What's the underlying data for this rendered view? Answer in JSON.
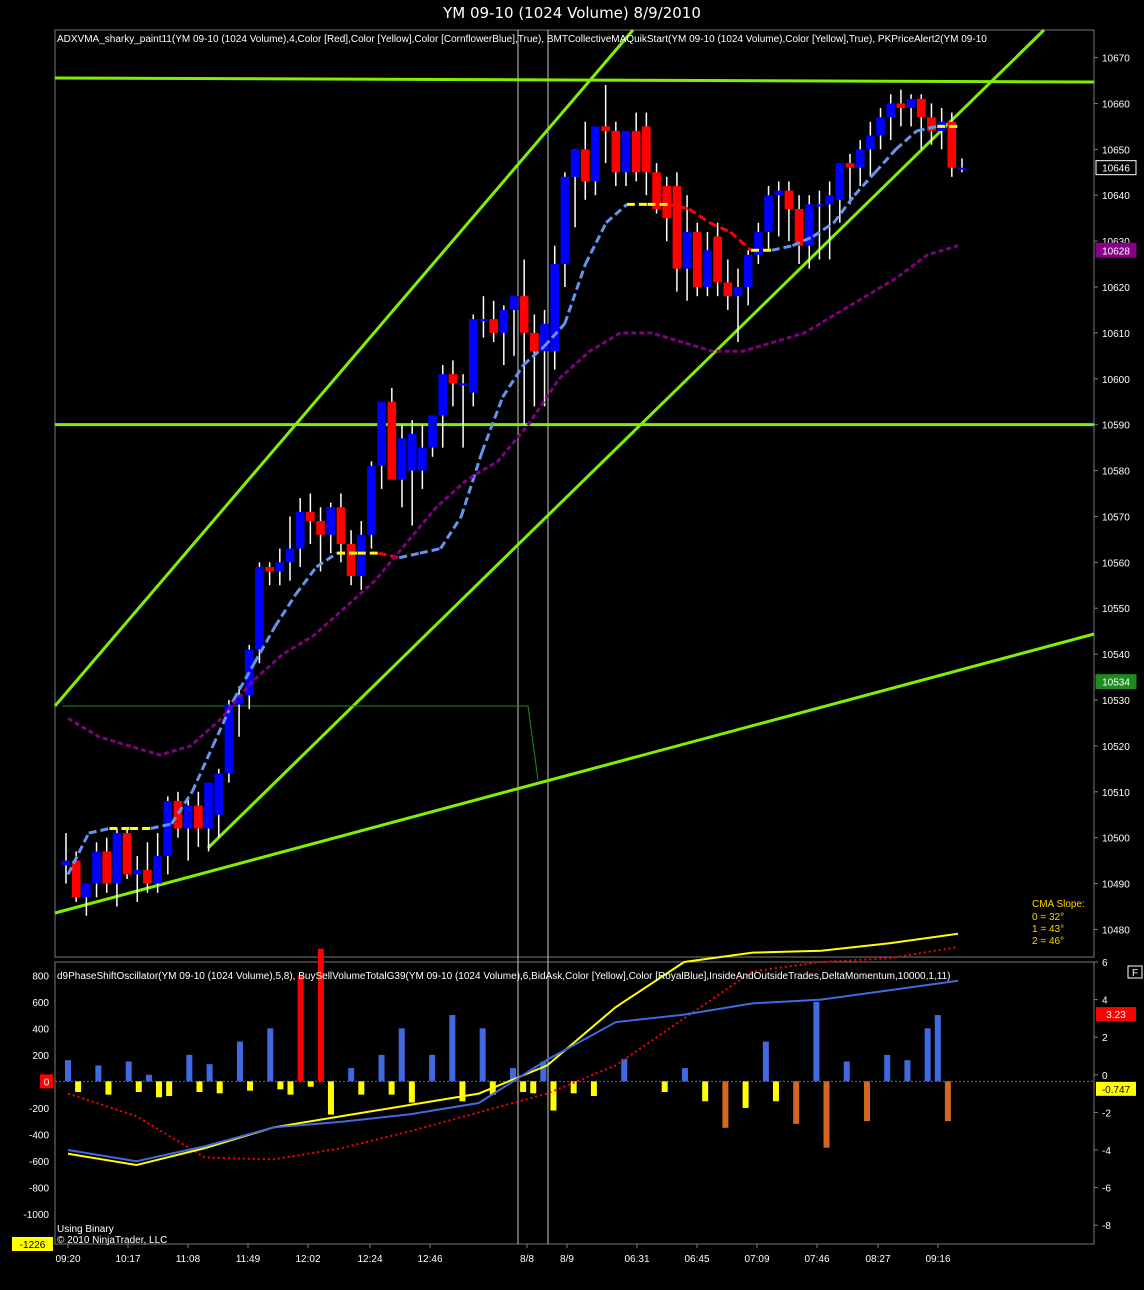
{
  "window": {
    "title": "YM 09-10 (1024 Volume)  8/9/2010"
  },
  "colors": {
    "bg": "#000000",
    "frame": "#7a7a7a",
    "up": "#0000ff",
    "down": "#ff0000",
    "trend": "#80f000",
    "cma_cool": "#6495ed",
    "cma_flat": "#ffff00",
    "cma_down": "#ff0000",
    "ma2": "#800080",
    "osc_fast": "#4169e1",
    "osc_slow": "#ffff00",
    "osc_sig": "#ff0000",
    "bar_up": "#4169e1",
    "bar_dn": "#ffff00"
  },
  "price_panel": {
    "header": "ADXVMA_sharky_paint11(YM 09-10 (1024 Volume),4,Color [Red],Color [Yellow],Color [CornflowerBlue],True), BMTCollectiveMAQuikStart(YM 09-10 (1024 Volume),Color [Yellow],True), PKPriceAlert2(YM 09-10",
    "cma_slope": {
      "title": "CMA Slope:",
      "lines": [
        "0 = 32°",
        "1 = 43°",
        "2 = 46°"
      ]
    },
    "price_tags": [
      {
        "text": "10646",
        "value": 10646,
        "bg": "#000000",
        "fg": "#ffffff",
        "border": "#ffffff"
      },
      {
        "text": "10628",
        "value": 10628,
        "bg": "#8b008b",
        "fg": "#ffffff",
        "border": "#8b008b"
      },
      {
        "text": "10534",
        "value": 10534,
        "bg": "#1e8b1e",
        "fg": "#ffffff",
        "border": "#1e8b1e"
      }
    ]
  },
  "osc_panel": {
    "header": "d9PhaseShiftOscillator(YM 09-10 (1024 Volume),5,8), BuySellVolumeTotalG39(YM 09-10 (1024 Volume),6,BidAsk,Color [Yellow],Color [RoyalBlue],InsideAndOutsideTrades,DeltaMomentum,10000,1,11)",
    "left_tags": [
      {
        "text": "0",
        "value": 0,
        "bg": "#ff0000"
      },
      {
        "text": "-1226",
        "value": -1226,
        "bg": "#ffff00"
      }
    ],
    "right_tags": [
      {
        "text": "3.23",
        "value": 3.23,
        "bg": "#ff0000",
        "fg": "#ffffff"
      },
      {
        "text": "-0.747",
        "value": -0.747,
        "bg": "#ffff00",
        "fg": "#000000"
      }
    ],
    "notes": [
      "Using Binary",
      "© 2010 NinjaTrader, LLC"
    ],
    "corner_label": "F"
  },
  "chart_data": [
    {
      "type": "candlestick",
      "title": "YM 09-10 (1024 Volume)  8/9/2010",
      "ylim": [
        10474,
        10676
      ],
      "y_ticks": [
        10670,
        10660,
        10650,
        10640,
        10630,
        10620,
        10610,
        10600,
        10590,
        10580,
        10570,
        10560,
        10550,
        10540,
        10530,
        10520,
        10510,
        10500,
        10490,
        10480
      ],
      "x_tick_labels": [
        "09:20",
        "10:17",
        "11:08",
        "11:49",
        "12:02",
        "12:24",
        "12:46",
        "8/8",
        "8/9",
        "06:31",
        "06:45",
        "07:09",
        "07:46",
        "08:27",
        "09:16"
      ],
      "candles": [
        {
          "o": 10494,
          "h": 10501,
          "l": 10490,
          "c": 10495
        },
        {
          "o": 10495,
          "h": 10497,
          "l": 10486,
          "c": 10487
        },
        {
          "o": 10487,
          "h": 10490,
          "l": 10483,
          "c": 10490
        },
        {
          "o": 10490,
          "h": 10499,
          "l": 10487,
          "c": 10497
        },
        {
          "o": 10497,
          "h": 10500,
          "l": 10488,
          "c": 10490
        },
        {
          "o": 10490,
          "h": 10502,
          "l": 10485,
          "c": 10501
        },
        {
          "o": 10501,
          "h": 10502,
          "l": 10491,
          "c": 10492
        },
        {
          "o": 10492,
          "h": 10496,
          "l": 10486,
          "c": 10493
        },
        {
          "o": 10493,
          "h": 10499,
          "l": 10488,
          "c": 10490
        },
        {
          "o": 10490,
          "h": 10501,
          "l": 10488,
          "c": 10496
        },
        {
          "o": 10496,
          "h": 10509,
          "l": 10492,
          "c": 10508
        },
        {
          "o": 10508,
          "h": 10510,
          "l": 10500,
          "c": 10502
        },
        {
          "o": 10502,
          "h": 10509,
          "l": 10495,
          "c": 10507
        },
        {
          "o": 10507,
          "h": 10510,
          "l": 10498,
          "c": 10502
        },
        {
          "o": 10502,
          "h": 10508,
          "l": 10497,
          "c": 10512
        },
        {
          "o": 10505,
          "h": 10515,
          "l": 10500,
          "c": 10514
        },
        {
          "o": 10514,
          "h": 10530,
          "l": 10512,
          "c": 10529
        },
        {
          "o": 10529,
          "h": 10533,
          "l": 10522,
          "c": 10531
        },
        {
          "o": 10531,
          "h": 10542,
          "l": 10528,
          "c": 10541
        },
        {
          "o": 10541,
          "h": 10560,
          "l": 10538,
          "c": 10559
        },
        {
          "o": 10559,
          "h": 10560,
          "l": 10555,
          "c": 10558
        },
        {
          "o": 10558,
          "h": 10563,
          "l": 10555,
          "c": 10560
        },
        {
          "o": 10560,
          "h": 10570,
          "l": 10556,
          "c": 10563
        },
        {
          "o": 10563,
          "h": 10574,
          "l": 10559,
          "c": 10571
        },
        {
          "o": 10571,
          "h": 10575,
          "l": 10564,
          "c": 10569
        },
        {
          "o": 10569,
          "h": 10572,
          "l": 10558,
          "c": 10566
        },
        {
          "o": 10566,
          "h": 10573,
          "l": 10562,
          "c": 10572
        },
        {
          "o": 10572,
          "h": 10575,
          "l": 10560,
          "c": 10564
        },
        {
          "o": 10564,
          "h": 10567,
          "l": 10555,
          "c": 10557
        },
        {
          "o": 10557,
          "h": 10569,
          "l": 10554,
          "c": 10566
        },
        {
          "o": 10566,
          "h": 10582,
          "l": 10563,
          "c": 10581
        },
        {
          "o": 10581,
          "h": 10593,
          "l": 10576,
          "c": 10595
        },
        {
          "o": 10595,
          "h": 10598,
          "l": 10586,
          "c": 10578
        },
        {
          "o": 10578,
          "h": 10590,
          "l": 10572,
          "c": 10587
        },
        {
          "o": 10580,
          "h": 10591,
          "l": 10568,
          "c": 10588
        },
        {
          "o": 10580,
          "h": 10590,
          "l": 10576,
          "c": 10585
        },
        {
          "o": 10585,
          "h": 10592,
          "l": 10583,
          "c": 10592
        },
        {
          "o": 10592,
          "h": 10603,
          "l": 10585,
          "c": 10601
        },
        {
          "o": 10601,
          "h": 10604,
          "l": 10594,
          "c": 10599
        },
        {
          "o": 10599,
          "h": 10601,
          "l": 10585,
          "c": 10599
        },
        {
          "o": 10597,
          "h": 10614,
          "l": 10594,
          "c": 10613
        },
        {
          "o": 10613,
          "h": 10618,
          "l": 10609,
          "c": 10613
        },
        {
          "o": 10613,
          "h": 10617,
          "l": 10608,
          "c": 10610
        },
        {
          "o": 10610,
          "h": 10616,
          "l": 10603,
          "c": 10615
        },
        {
          "o": 10615,
          "h": 10618,
          "l": 10605,
          "c": 10618
        },
        {
          "o": 10618,
          "h": 10626,
          "l": 10590,
          "c": 10610
        },
        {
          "o": 10610,
          "h": 10614,
          "l": 10594,
          "c": 10606
        },
        {
          "o": 10606,
          "h": 10615,
          "l": 10594,
          "c": 10612
        },
        {
          "o": 10606,
          "h": 10629,
          "l": 10602,
          "c": 10625
        },
        {
          "o": 10625,
          "h": 10645,
          "l": 10620,
          "c": 10644
        },
        {
          "o": 10644,
          "h": 10650,
          "l": 10633,
          "c": 10650
        },
        {
          "o": 10650,
          "h": 10656,
          "l": 10639,
          "c": 10643
        },
        {
          "o": 10643,
          "h": 10654,
          "l": 10640,
          "c": 10655
        },
        {
          "o": 10655,
          "h": 10664,
          "l": 10647,
          "c": 10654
        },
        {
          "o": 10654,
          "h": 10656,
          "l": 10642,
          "c": 10645
        },
        {
          "o": 10645,
          "h": 10654,
          "l": 10642,
          "c": 10654
        },
        {
          "o": 10654,
          "h": 10658,
          "l": 10643,
          "c": 10645
        },
        {
          "o": 10655,
          "h": 10658,
          "l": 10640,
          "c": 10645
        },
        {
          "o": 10645,
          "h": 10647,
          "l": 10636,
          "c": 10637
        },
        {
          "o": 10642,
          "h": 10644,
          "l": 10630,
          "c": 10635
        },
        {
          "o": 10642,
          "h": 10645,
          "l": 10619,
          "c": 10624
        },
        {
          "o": 10624,
          "h": 10640,
          "l": 10617,
          "c": 10632
        },
        {
          "o": 10632,
          "h": 10634,
          "l": 10618,
          "c": 10620
        },
        {
          "o": 10620,
          "h": 10632,
          "l": 10618,
          "c": 10628
        },
        {
          "o": 10631,
          "h": 10634,
          "l": 10618,
          "c": 10621
        },
        {
          "o": 10621,
          "h": 10626,
          "l": 10615,
          "c": 10618
        },
        {
          "o": 10618,
          "h": 10624,
          "l": 10608,
          "c": 10620
        },
        {
          "o": 10620,
          "h": 10628,
          "l": 10616,
          "c": 10627
        },
        {
          "o": 10627,
          "h": 10634,
          "l": 10625,
          "c": 10632
        },
        {
          "o": 10632,
          "h": 10642,
          "l": 10628,
          "c": 10640
        },
        {
          "o": 10640,
          "h": 10643,
          "l": 10631,
          "c": 10641
        },
        {
          "o": 10641,
          "h": 10643,
          "l": 10630,
          "c": 10637
        },
        {
          "o": 10637,
          "h": 10640,
          "l": 10625,
          "c": 10629
        },
        {
          "o": 10629,
          "h": 10640,
          "l": 10624,
          "c": 10638
        },
        {
          "o": 10638,
          "h": 10641,
          "l": 10626,
          "c": 10638
        },
        {
          "o": 10638,
          "h": 10643,
          "l": 10626,
          "c": 10640
        },
        {
          "o": 10639,
          "h": 10647,
          "l": 10634,
          "c": 10647
        },
        {
          "o": 10647,
          "h": 10649,
          "l": 10638,
          "c": 10646
        },
        {
          "o": 10646,
          "h": 10652,
          "l": 10642,
          "c": 10650
        },
        {
          "o": 10650,
          "h": 10656,
          "l": 10644,
          "c": 10653
        },
        {
          "o": 10653,
          "h": 10659,
          "l": 10650,
          "c": 10657
        },
        {
          "o": 10657,
          "h": 10662,
          "l": 10652,
          "c": 10660
        },
        {
          "o": 10660,
          "h": 10663,
          "l": 10655,
          "c": 10659
        },
        {
          "o": 10659,
          "h": 10662,
          "l": 10655,
          "c": 10661
        },
        {
          "o": 10661,
          "h": 10662,
          "l": 10650,
          "c": 10657
        },
        {
          "o": 10657,
          "h": 10660,
          "l": 10651,
          "c": 10654
        },
        {
          "o": 10654,
          "h": 10659,
          "l": 10650,
          "c": 10656
        },
        {
          "o": 10656,
          "h": 10658,
          "l": 10644,
          "c": 10646
        },
        {
          "o": 10646,
          "h": 10648,
          "l": 10645,
          "c": 10646
        }
      ],
      "lines": [
        {
          "name": "cma_fast",
          "color_mode": "segments",
          "values": [
            10492,
            10501,
            10502,
            10502,
            10502,
            10503,
            10510,
            10520,
            10530,
            10538,
            10546,
            10553,
            10559,
            10562,
            10562,
            10562,
            10561,
            10562,
            10563,
            10570,
            10584,
            10596,
            10603,
            10607,
            10612,
            10625,
            10634,
            10638,
            10638,
            10638,
            10637,
            10634,
            10632,
            10628,
            10628,
            10629,
            10631,
            10634,
            10640,
            10645,
            10650,
            10654,
            10655,
            10655
          ]
        },
        {
          "name": "ma_long",
          "values": [
            10526,
            10522,
            10520,
            10518,
            10520,
            10526,
            10534,
            10540,
            10544,
            10550,
            10556,
            10564,
            10572,
            10578,
            10582,
            10590,
            10600,
            10606,
            10610,
            10610,
            10608,
            10606,
            10606,
            10608,
            10610,
            10614,
            10618,
            10622,
            10627,
            10629
          ]
        }
      ],
      "hlines": [
        10590
      ]
    },
    {
      "type": "bar+line",
      "ylim_left": [
        -1226,
        900
      ],
      "ylim_right": [
        -9,
        6
      ],
      "left_ticks": [
        800,
        600,
        400,
        200,
        0,
        -200,
        -400,
        -600,
        -800,
        -1000
      ],
      "right_ticks": [
        6,
        4,
        2,
        0,
        -2,
        -4,
        -6,
        -8
      ],
      "volume_bars": [
        160,
        -80,
        0,
        120,
        -100,
        0,
        150,
        -80,
        50,
        -120,
        -110,
        0,
        200,
        -80,
        130,
        -90,
        0,
        300,
        -70,
        0,
        400,
        -60,
        -100,
        800,
        -40,
        1000,
        -250,
        0,
        100,
        -100,
        0,
        200,
        -100,
        400,
        -160,
        0,
        200,
        0,
        500,
        -150,
        0,
        400,
        -100,
        0,
        100,
        -80,
        -90,
        150,
        -220,
        0,
        -90,
        0,
        -110,
        0,
        0,
        170,
        0,
        0,
        0,
        -80,
        0,
        100,
        0,
        -150,
        0,
        -350,
        0,
        -200,
        0,
        300,
        -150,
        0,
        -320,
        0,
        600,
        -500,
        0,
        150,
        0,
        -300,
        0,
        200,
        0,
        160,
        0,
        400,
        500,
        -300,
        0
      ],
      "osc_fast": [
        -4,
        -4.6,
        -3.8,
        -2.8,
        -2.5,
        -2.1,
        -1.5,
        0.8,
        2.8,
        3.2,
        3.8,
        4.0,
        4.5,
        5.0
      ],
      "osc_slow": [
        -4.2,
        -4.8,
        -3.9,
        -2.8,
        -2.2,
        -1.6,
        -1.0,
        0.5,
        3.6,
        6.0,
        6.5,
        6.6,
        7.0,
        7.5
      ],
      "osc_sig": [
        -1.0,
        -2.2,
        -4.4,
        -4.5,
        -3.9,
        -3.0,
        -2.0,
        -1.0,
        0.5,
        3.0,
        5.5,
        6.0,
        6.2,
        6.8
      ]
    }
  ]
}
